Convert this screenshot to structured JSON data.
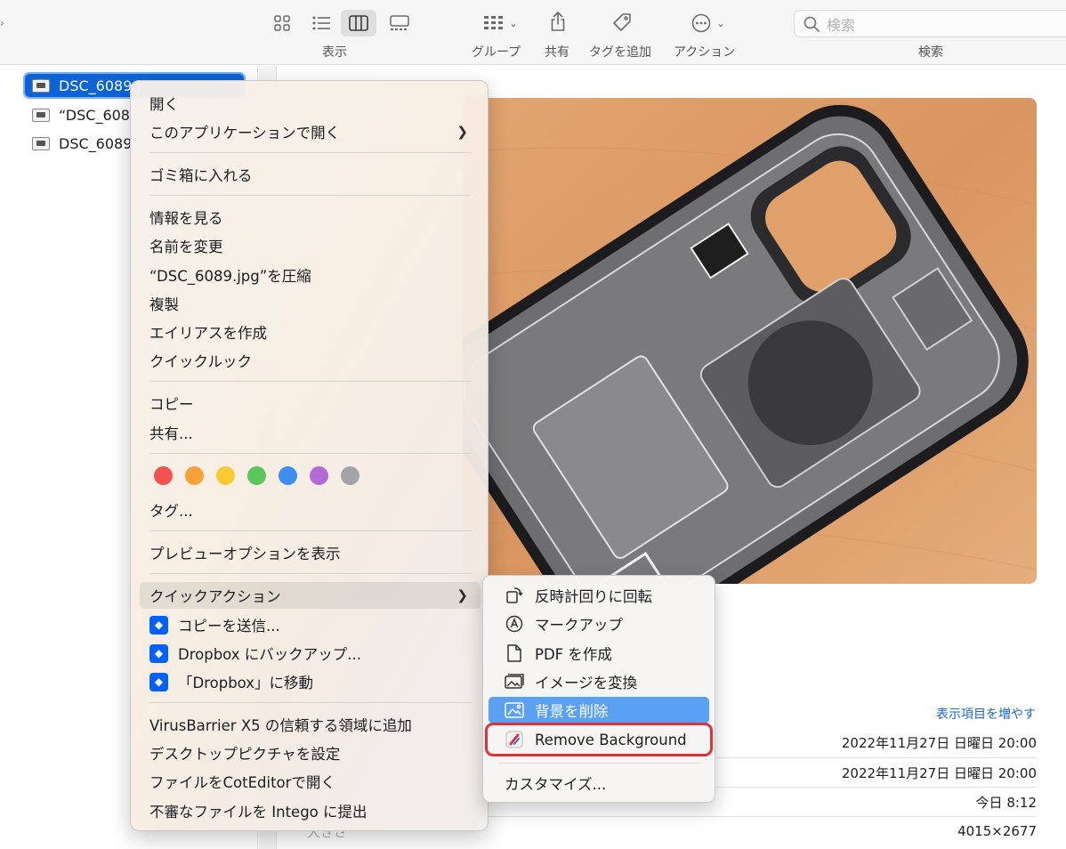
{
  "toolbar": {
    "view_label": "表示",
    "group_label": "グループ",
    "share_label": "共有",
    "add_tag_label": "タグを追加",
    "action_label": "アクション",
    "search_label": "検索",
    "search_placeholder": "検索"
  },
  "files": [
    {
      "name": "DSC_6089.j",
      "selected": true
    },
    {
      "name": "“DSC_608",
      "selected": false
    },
    {
      "name": "DSC_6089",
      "selected": false
    }
  ],
  "context_menu": {
    "open": "開く",
    "open_with": "このアプリケーションで開く",
    "trash": "ゴミ箱に入れる",
    "get_info": "情報を見る",
    "rename": "名前を変更",
    "compress": "“DSC_6089.jpg”を圧縮",
    "duplicate": "複製",
    "make_alias": "エイリアスを作成",
    "quick_look": "クイックルック",
    "copy": "コピー",
    "share": "共有...",
    "tags": "タグ...",
    "show_preview_options": "プレビューオプションを表示",
    "quick_actions": "クイックアクション",
    "send_copy": "コピーを送信...",
    "dropbox_backup": "Dropbox にバックアップ...",
    "dropbox_move": "「Dropbox」に移動",
    "virusbarrier": "VirusBarrier X5 の信頼する領域に追加",
    "set_desktop": "デスクトップピクチャを設定",
    "open_coteditor": "ファイルをCotEditorで開く",
    "intego_submit": "不審なファイルを Intego に提出",
    "tag_colors": [
      "#f05350",
      "#f7a236",
      "#f6cc35",
      "#5bc65a",
      "#3d8ef0",
      "#b36ad6",
      "#a3a3a8"
    ]
  },
  "submenu": {
    "rotate_left": "反時計回りに回転",
    "markup": "マークアップ",
    "create_pdf": "PDF を作成",
    "convert_image": "イメージを変換",
    "remove_bg_jp": "背景を削除",
    "remove_bg_en": "Remove Background",
    "customize": "カスタマイズ..."
  },
  "info": {
    "more_link": "表示項目を増やす",
    "created": "2022年11月27日 日曜日 20:00",
    "modified": "2022年11月27日 日曜日 20:00",
    "last_opened": "今日 8:12",
    "size_label": "大きさ",
    "dimensions": "4015×2677"
  },
  "colors": {
    "accent": "#0a64d8",
    "highlight": "#5aa0f5",
    "annotation_red": "#e0303a",
    "link": "#1b66c9"
  }
}
